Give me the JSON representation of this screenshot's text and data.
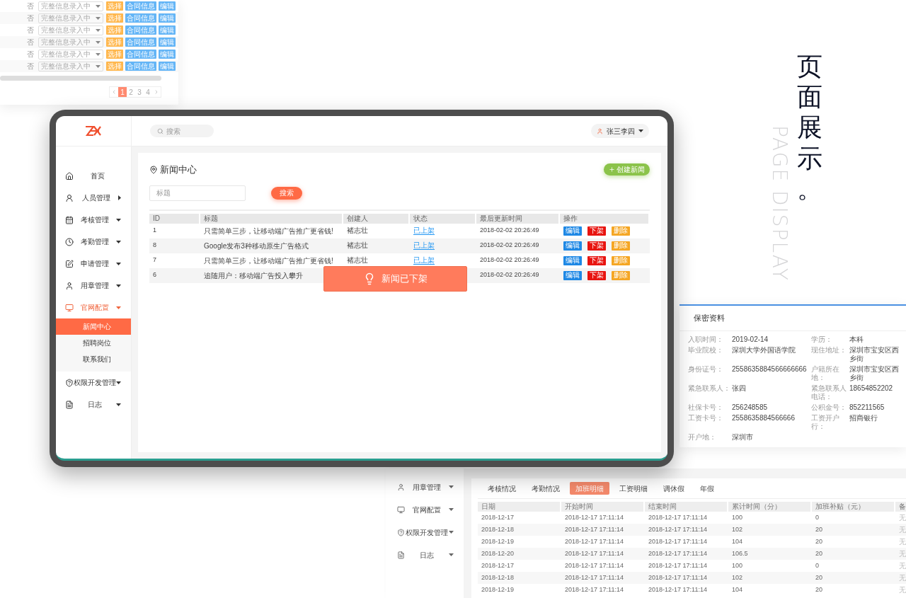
{
  "list_fragment": {
    "rows": [
      {
        "flag": "否",
        "status_select": "完整信息录入中",
        "actions": [
          {
            "label": "选择",
            "color": "#ffb74d"
          },
          {
            "label": "合同信息",
            "color": "#64b5f6"
          },
          {
            "label": "编辑",
            "color": "#64b5f6"
          }
        ]
      },
      {
        "flag": "否",
        "status_select": "完整信息录入中",
        "actions": [
          {
            "label": "选择",
            "color": "#ffb74d"
          },
          {
            "label": "合同信息",
            "color": "#64b5f6"
          },
          {
            "label": "编辑",
            "color": "#64b5f6"
          }
        ]
      },
      {
        "flag": "否",
        "status_select": "完整信息录入中",
        "actions": [
          {
            "label": "选择",
            "color": "#ffb74d"
          },
          {
            "label": "合同信息",
            "color": "#64b5f6"
          },
          {
            "label": "编辑",
            "color": "#64b5f6"
          }
        ]
      },
      {
        "flag": "否",
        "status_select": "完整信息录入中",
        "actions": [
          {
            "label": "选择",
            "color": "#ffb74d"
          },
          {
            "label": "合同信息",
            "color": "#64b5f6"
          },
          {
            "label": "编辑",
            "color": "#64b5f6"
          }
        ]
      },
      {
        "flag": "否",
        "status_select": "完整信息录入中",
        "actions": [
          {
            "label": "选择",
            "color": "#ffb74d"
          },
          {
            "label": "合同信息",
            "color": "#64b5f6"
          },
          {
            "label": "编辑",
            "color": "#64b5f6"
          }
        ]
      },
      {
        "flag": "否",
        "status_select": "完整信息录入中",
        "actions": [
          {
            "label": "选择",
            "color": "#ffb74d"
          },
          {
            "label": "合同信息",
            "color": "#64b5f6"
          },
          {
            "label": "编辑",
            "color": "#64b5f6"
          }
        ]
      }
    ],
    "pagination": [
      {
        "label": "1",
        "selected": true
      },
      {
        "label": "2",
        "selected": false
      },
      {
        "label": "3",
        "selected": false
      },
      {
        "label": "4",
        "selected": false
      }
    ]
  },
  "showcase_heading": {
    "title": "页面展示。",
    "subtitle": "PAGE DISPLAY"
  },
  "tablet": {
    "search": {
      "placeholder": "搜索"
    },
    "user": "张三李四",
    "sidebar": {
      "items": [
        {
          "label": "首页",
          "kind": "link",
          "selected": false
        },
        {
          "label": "人员管理",
          "kind": "flyout",
          "selected": false
        },
        {
          "label": "考核管理",
          "kind": "dropdown",
          "selected": false
        },
        {
          "label": "考勤管理",
          "kind": "dropdown",
          "selected": false
        },
        {
          "label": "申请管理",
          "kind": "dropdown",
          "selected": false
        },
        {
          "label": "用章管理",
          "kind": "dropdown",
          "selected": false
        },
        {
          "label": "官网配置",
          "kind": "dropdown",
          "selected": true,
          "children": [
            {
              "label": "新闻中心",
              "selected": true
            },
            {
              "label": "招聘岗位",
              "selected": false
            },
            {
              "label": "联系我们",
              "selected": false
            }
          ]
        },
        {
          "label": "权限开发管理",
          "kind": "dropdown",
          "selected": false
        },
        {
          "label": "日志",
          "kind": "dropdown",
          "selected": false
        }
      ]
    },
    "page": {
      "title": "新闻中心",
      "create_button": "创建新闻",
      "filter": {
        "placeholder": "标题"
      },
      "search_button": "搜索",
      "table": {
        "columns": [
          "ID",
          "标题",
          "创建人",
          "状态",
          "最后更新时间",
          "操作"
        ],
        "rows": [
          {
            "id": "1",
            "title": "只需简单三步，让移动端广告推广更省钱!",
            "creator": "褚志壮",
            "status": "已上架",
            "updated": "2018-02-02 20:26:49",
            "actions": [
              {
                "label": "编辑",
                "color": "#1e88e5"
              },
              {
                "label": "下架",
                "color": "#e8140f"
              },
              {
                "label": "删除",
                "color": "#f5a623"
              }
            ]
          },
          {
            "id": "8",
            "title": "Google发布3种移动原生广告格式",
            "creator": "褚志壮",
            "status": "已上架",
            "updated": "2018-02-02 20:26:49",
            "actions": [
              {
                "label": "编辑",
                "color": "#1e88e5"
              },
              {
                "label": "下架",
                "color": "#e8140f"
              },
              {
                "label": "删除",
                "color": "#f5a623"
              }
            ]
          },
          {
            "id": "7",
            "title": "只需简单三步，让移动端广告推广更省钱!",
            "creator": "褚志壮",
            "status": "已上架",
            "updated": "2018-02-02 20:26:49",
            "actions": [
              {
                "label": "编辑",
                "color": "#1e88e5"
              },
              {
                "label": "下架",
                "color": "#e8140f"
              },
              {
                "label": "删除",
                "color": "#f5a623"
              }
            ]
          },
          {
            "id": "6",
            "title": "追随用户：移动端广告投入攀升",
            "updated": "2018-02-02 20:26:49",
            "actions": [
              {
                "label": "编辑",
                "color": "#1e88e5"
              },
              {
                "label": "下架",
                "color": "#e8140f"
              },
              {
                "label": "删除",
                "color": "#f5a623"
              }
            ]
          }
        ]
      }
    },
    "toast": {
      "message": "新闻已下架"
    }
  },
  "profile_panel": {
    "title": "保密资料",
    "rows": [
      {
        "left": {
          "label": "入职时间：",
          "value": "2019-02-14"
        },
        "right": {
          "label": "学历：",
          "value": "本科"
        }
      },
      {
        "left": {
          "label": "毕业院校：",
          "value": "深圳大学外国语学院"
        },
        "right": {
          "label": "现住地址：",
          "value": "深圳市宝安区西乡街"
        }
      },
      {
        "left": {
          "label": "身份证号：",
          "value": "2558635884566666666"
        },
        "right": {
          "label": "户籍所在地：",
          "value": "深圳市宝安区西乡街"
        }
      },
      {
        "left": {
          "label": "紧急联系人：",
          "value": "张四"
        },
        "right": {
          "label": "紧急联系人电话：",
          "value": "18654852202"
        }
      },
      {
        "left": {
          "label": "社保卡号：",
          "value": "256248585"
        },
        "right": {
          "label": "公积金号：",
          "value": "852211565"
        }
      },
      {
        "left": {
          "label": "工资卡号：",
          "value": "2558635884566666"
        },
        "right": {
          "label": "工资开户行：",
          "value": "招商银行"
        }
      },
      {
        "left": {
          "label": "开户地：",
          "value": "深圳市"
        }
      }
    ]
  },
  "detail_panel": {
    "sidebar": {
      "items": [
        {
          "label": "用章管理"
        },
        {
          "label": "官网配置"
        },
        {
          "label": "权限开发管理"
        },
        {
          "label": "日志"
        }
      ]
    },
    "tabs": [
      {
        "label": "考核情况",
        "selected": false
      },
      {
        "label": "考勤情况",
        "selected": false
      },
      {
        "label": "加班明细",
        "selected": true
      },
      {
        "label": "工资明细",
        "selected": false
      },
      {
        "label": "调休假",
        "selected": false
      },
      {
        "label": "年假",
        "selected": false
      }
    ],
    "table": {
      "columns": [
        "日期",
        "开始时间",
        "结束时间",
        "累计时间（分）",
        "加班补贴（元）",
        "备"
      ],
      "rows": [
        [
          "2018-12-17",
          "2018-12-17 17:11:14",
          "2018-12-17 17:11:14",
          "100",
          "0",
          "无"
        ],
        [
          "2018-12-18",
          "2018-12-17 17:11:14",
          "2018-12-17 17:11:14",
          "102",
          "20",
          "无"
        ],
        [
          "2018-12-19",
          "2018-12-17 17:11:14",
          "2018-12-17 17:11:14",
          "104",
          "20",
          "无"
        ],
        [
          "2018-12-20",
          "2018-12-17 17:11:14",
          "2018-12-17 17:11:14",
          "106.5",
          "20",
          "无"
        ],
        [
          "2018-12-17",
          "2018-12-17 17:11:14",
          "2018-12-17 17:11:14",
          "100",
          "0",
          "无"
        ],
        [
          "2018-12-18",
          "2018-12-17 17:11:14",
          "2018-12-17 17:11:14",
          "102",
          "20",
          "无"
        ],
        [
          "2018-12-19",
          "2018-12-17 17:11:14",
          "2018-12-17 17:11:14",
          "104",
          "20",
          "无"
        ]
      ]
    }
  }
}
